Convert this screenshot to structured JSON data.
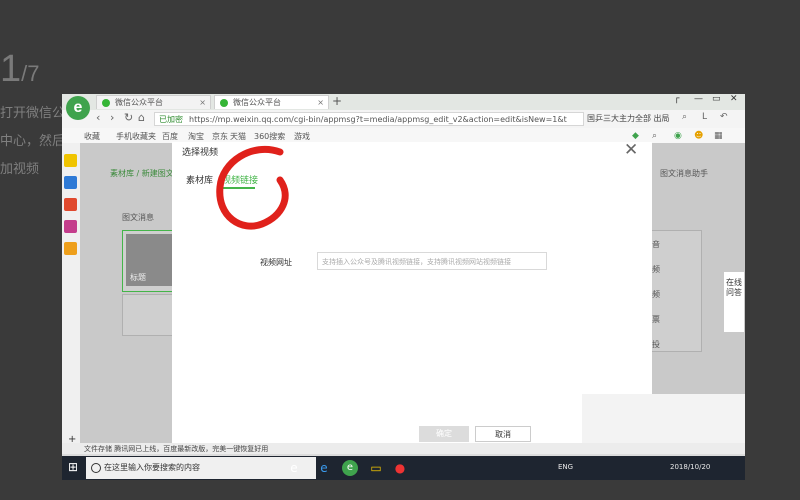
{
  "background": {
    "big_number": "1",
    "sub_number": "/7",
    "line1": "打开微信公",
    "line2": "中心，然后",
    "line3": "加视频"
  },
  "browser": {
    "logo": "e",
    "tabs": [
      {
        "label": "微信公众平台"
      },
      {
        "label": "微信公众平台"
      }
    ],
    "add_tab": "+",
    "nav": {
      "back": "‹",
      "forward": "›",
      "refresh": "↻",
      "home": "⌂"
    },
    "address": {
      "secure_label": "已加密",
      "url": "https://mp.weixin.qq.com/cgi-bin/appmsg?t=media/appmsg_edit_v2&action=edit&isNew=1&t"
    },
    "search_hint": "国乒三大主力全部 出局",
    "favorites": [
      "收藏",
      "手机收藏夹",
      "百度",
      "淘宝",
      "京东",
      "天猫",
      "360搜索",
      "游戏"
    ]
  },
  "page": {
    "breadcrumb": "素材库 / 新建图文",
    "right_text": "图文消息助手",
    "card_label": "图文消息",
    "thumb_label": "标题",
    "side_labels": [
      "音",
      "频",
      "频",
      "票",
      "投"
    ]
  },
  "modal": {
    "title": "选择视频",
    "tab_library": "素材库",
    "tab_link": "视频链接",
    "field_label": "视频网址",
    "placeholder": "支持插入公众号及腾讯视频链接，支持腾讯视频网站视频链接",
    "confirm": "确定",
    "cancel": "取消",
    "close": "✕"
  },
  "side_popup": {
    "text": "在线问答"
  },
  "footer_status": "文件存储  腾讯网已上线，百度最新改版，完美一键恢复好用",
  "taskbar": {
    "search_placeholder": "在这里输入你要搜索的内容",
    "tray_text": "ENG",
    "date": "2018/10/20"
  },
  "colors": {
    "accent": "#44b549",
    "annotation": "#e0211b",
    "taskbar": "#1e2530"
  }
}
